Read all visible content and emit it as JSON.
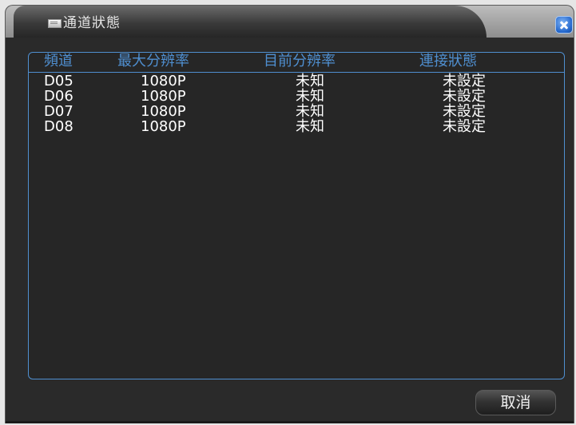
{
  "window": {
    "title": "通道狀態",
    "icon": "envelope-icon"
  },
  "table": {
    "headers": [
      "頻道",
      "最大分辨率",
      "目前分辨率",
      "連接狀態"
    ],
    "rows": [
      [
        "D05",
        "1080P",
        "未知",
        "未設定"
      ],
      [
        "D06",
        "1080P",
        "未知",
        "未設定"
      ],
      [
        "D07",
        "1080P",
        "未知",
        "未設定"
      ],
      [
        "D08",
        "1080P",
        "未知",
        "未設定"
      ]
    ]
  },
  "buttons": {
    "cancel": "取消",
    "close_icon": "close-icon"
  },
  "colors": {
    "accent": "#4f8fd0",
    "window_bg": "#2a2a2a",
    "text": "#ffffff",
    "close_button": "#2266cc"
  }
}
